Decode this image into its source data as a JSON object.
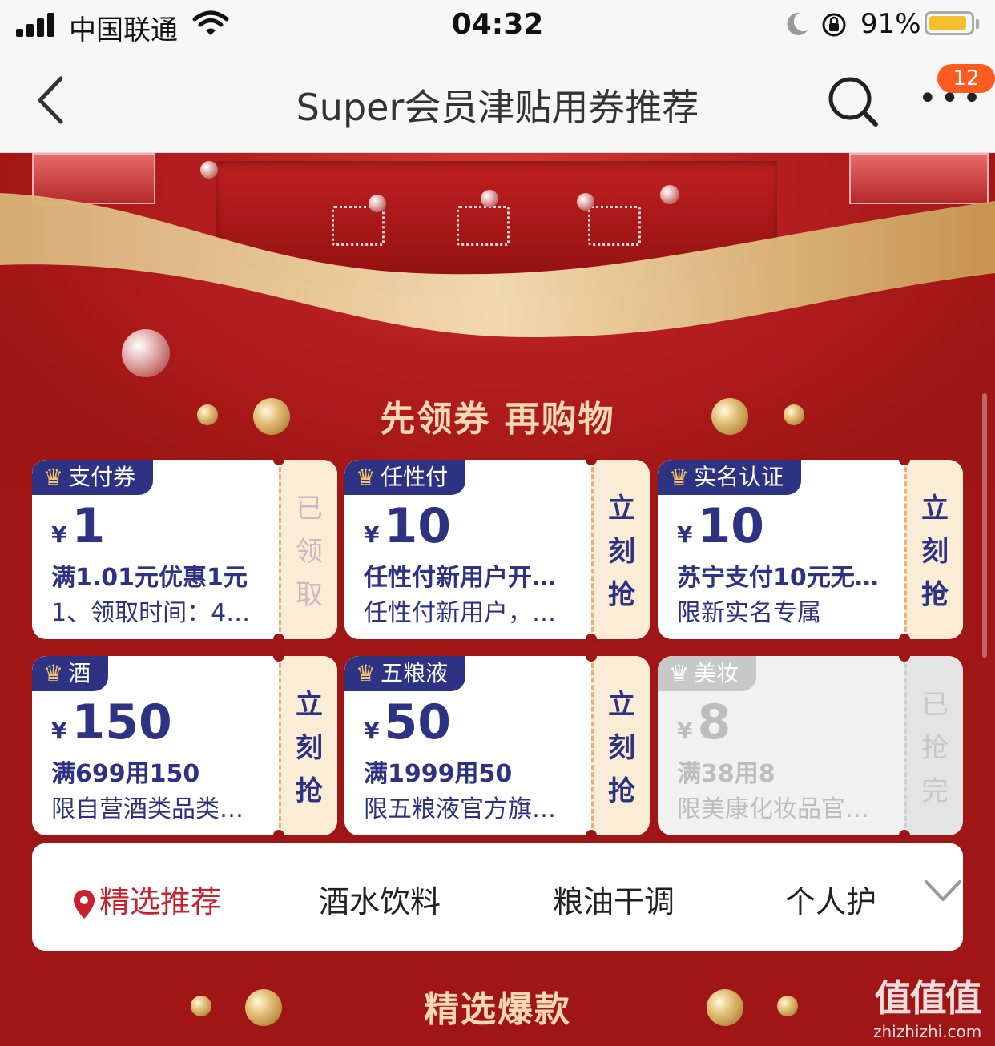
{
  "status_bar": {
    "carrier": "中国联通",
    "time": "04:32",
    "battery_percent": "91%",
    "battery_level": 0.91
  },
  "nav": {
    "title": "Super会员津贴用券推荐",
    "badge_count": "12"
  },
  "banner": {
    "headline": "先领券 再购物",
    "section_title": "精选爆款"
  },
  "coupons": [
    {
      "tag": "支付券",
      "yen": "¥",
      "amount": "1",
      "condition": "满1.01元优惠1元",
      "description": "1、领取时间：4…",
      "action": [
        "已",
        "领",
        "取"
      ],
      "state": "claimed"
    },
    {
      "tag": "任性付",
      "yen": "¥",
      "amount": "10",
      "condition": "任性付新用户开…",
      "description": "任性付新用户，…",
      "action": [
        "立",
        "刻",
        "抢"
      ],
      "state": "active"
    },
    {
      "tag": "实名认证",
      "yen": "¥",
      "amount": "10",
      "condition": "苏宁支付10元无…",
      "description": "限新实名专属",
      "action": [
        "立",
        "刻",
        "抢"
      ],
      "state": "active"
    },
    {
      "tag": "酒",
      "yen": "¥",
      "amount": "150",
      "condition": "满699用150",
      "description": "限自营酒类品类…",
      "action": [
        "立",
        "刻",
        "抢"
      ],
      "state": "active"
    },
    {
      "tag": "五粮液",
      "yen": "¥",
      "amount": "50",
      "condition": "满1999用50",
      "description": "限五粮液官方旗…",
      "action": [
        "立",
        "刻",
        "抢"
      ],
      "state": "active"
    },
    {
      "tag": "美妆",
      "yen": "¥",
      "amount": "8",
      "condition": "满38用8",
      "description": "限美康化妆品官…",
      "action": [
        "已",
        "抢",
        "完"
      ],
      "state": "sold_out"
    }
  ],
  "category_tabs": [
    {
      "label": "精选推荐",
      "active": true
    },
    {
      "label": "酒水饮料",
      "active": false
    },
    {
      "label": "粮油干调",
      "active": false
    },
    {
      "label": "个人护",
      "active": false
    }
  ],
  "watermark": {
    "logo": "值值值",
    "domain": "zhizhizhi.com"
  },
  "colors": {
    "background": "#9e1515",
    "coupon_text": "#2d3282",
    "coupon_side": "#fbecd6",
    "active_tab": "#c8202d",
    "badge": "#ff5a1f",
    "headline": "#f7d8b0"
  }
}
